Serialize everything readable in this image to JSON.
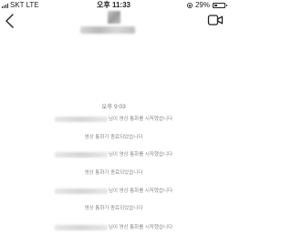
{
  "status_bar": {
    "carrier": "SKT",
    "network": "LTE",
    "time": "오후 11:33",
    "battery_percent": "29%",
    "battery_level": 0.29
  },
  "nav": {
    "back_icon": "chevron-left-icon",
    "video_icon": "video-call-icon"
  },
  "chat": {
    "time_label": "오후 9:03",
    "messages": [
      {
        "text": "님이 영상 통화를 시작했습니다",
        "has_name": true
      },
      {
        "text": "영상 통화가 종료되었습니다",
        "has_name": false
      },
      {
        "text": "님이 영상 통화를 시작했습니다",
        "has_name": true
      },
      {
        "text": "영상 통화가 종료되었습니다",
        "has_name": false
      },
      {
        "text": "님이 영상 통화를 시작했습니다",
        "has_name": true
      },
      {
        "text": "영상 통화가 종료되었습니다",
        "has_name": false
      },
      {
        "text": "님이 영상 통화를 시작했습니다",
        "has_name": true
      }
    ]
  }
}
